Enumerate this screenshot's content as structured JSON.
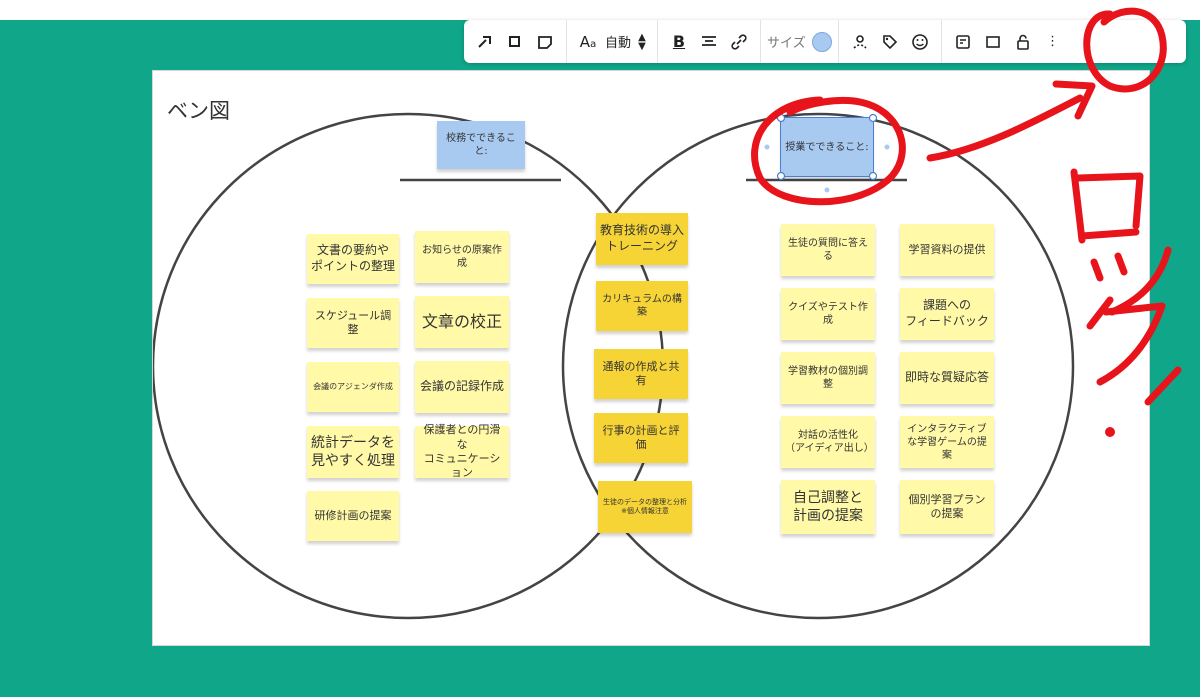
{
  "toolbar": {
    "font_label": "自動",
    "size_label": "サイズ",
    "size_color": "#a8c9f0",
    "icons": [
      "connector-icon",
      "shape-icon",
      "sticky-note-icon",
      "font-icon",
      "stepper-icon",
      "bold-icon",
      "align-icon",
      "link-icon",
      "author-icon",
      "tag-icon",
      "emoji-icon",
      "layout-icon",
      "frame-icon",
      "lock-icon",
      "more-icon"
    ]
  },
  "board": {
    "title": "ベン図",
    "left_header": "校務でできること:",
    "right_header": "授業でできること:",
    "left_notes": [
      "文書の要約や\nポイントの整理",
      "お知らせの原案作成",
      "スケジュール調整",
      "文章の校正",
      "会議のアジェンダ作成",
      "会議の記録作成",
      "統計データを\n見やすく処理",
      "保護者との円滑な\nコミュニケーション",
      "研修計画の提案"
    ],
    "middle_notes": [
      "教育技術の導入\nトレーニング",
      "カリキュラムの構築",
      "通報の作成と共有",
      "行事の計画と評価",
      "生徒のデータの整理と分析\n※個人情報注意"
    ],
    "right_notes": [
      "生徒の質問に答える",
      "学習資料の提供",
      "クイズやテスト作成",
      "課題への\nフィードバック",
      "学習教材の個別調整",
      "即時な質疑応答",
      "対話の活性化\n（アイディア出し）",
      "インタラクティブ\nな学習ゲームの提\n案",
      "自己調整と\n計画の提案",
      "個別学習プラン\nの提案"
    ]
  },
  "annotation": {
    "text": "ロック！",
    "color": "#e8141c"
  }
}
